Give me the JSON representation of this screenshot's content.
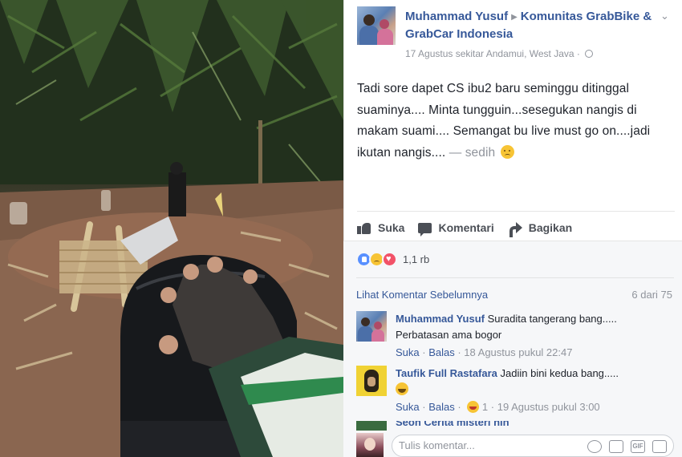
{
  "post": {
    "author": "Muhammad Yusuf",
    "group": "Komunitas GrabBike & GrabCar Indonesia",
    "meta": "17 Agustus sekitar Andamui, West Java ·",
    "text": "Tadi sore dapet CS ibu2 baru seminggu ditinggal suaminya.... Minta tungguin...sesegukan nangis di makam suami.... Semangat bu live must go on....jadi ikutan nangis....",
    "feeling": "— sedih",
    "feeling_icon": "sad-face-icon",
    "privacy_icon": "globe-icon"
  },
  "actions": {
    "like": "Suka",
    "comment": "Komentari",
    "share": "Bagikan"
  },
  "reactions": {
    "count": "1,1 rb",
    "icons": [
      "like-icon",
      "sad-icon",
      "love-icon"
    ],
    "colors": {
      "like": "#5890ff",
      "sad": "#f7c435",
      "love": "#f25268"
    }
  },
  "comments_section": {
    "prev_label": "Lihat Komentar Sebelumnya",
    "page_count": "6 dari 75",
    "comments": [
      {
        "name": "Muhammad Yusuf",
        "text": "Suradita tangerang bang..... Perbatasan ama bogor",
        "like": "Suka",
        "reply": "Balas",
        "time": "18 Agustus pukul 22:47"
      },
      {
        "name": "Taufik Full Rastafara",
        "text": "Jadiin bini kedua bang.....",
        "like": "Suka",
        "reply": "Balas",
        "reaction_count": "1",
        "time": "19 Agustus pukul 3:00"
      }
    ],
    "partial_name": "Seon Cerita misteri nih"
  },
  "composer": {
    "placeholder": "Tulis komentar...",
    "icons": [
      "emoji-icon",
      "camera-icon",
      "gif-icon",
      "sticker-icon"
    ],
    "gif_label": "GIF"
  },
  "colors": {
    "link": "#365899",
    "muted": "#90949c",
    "text": "#1d2129"
  }
}
